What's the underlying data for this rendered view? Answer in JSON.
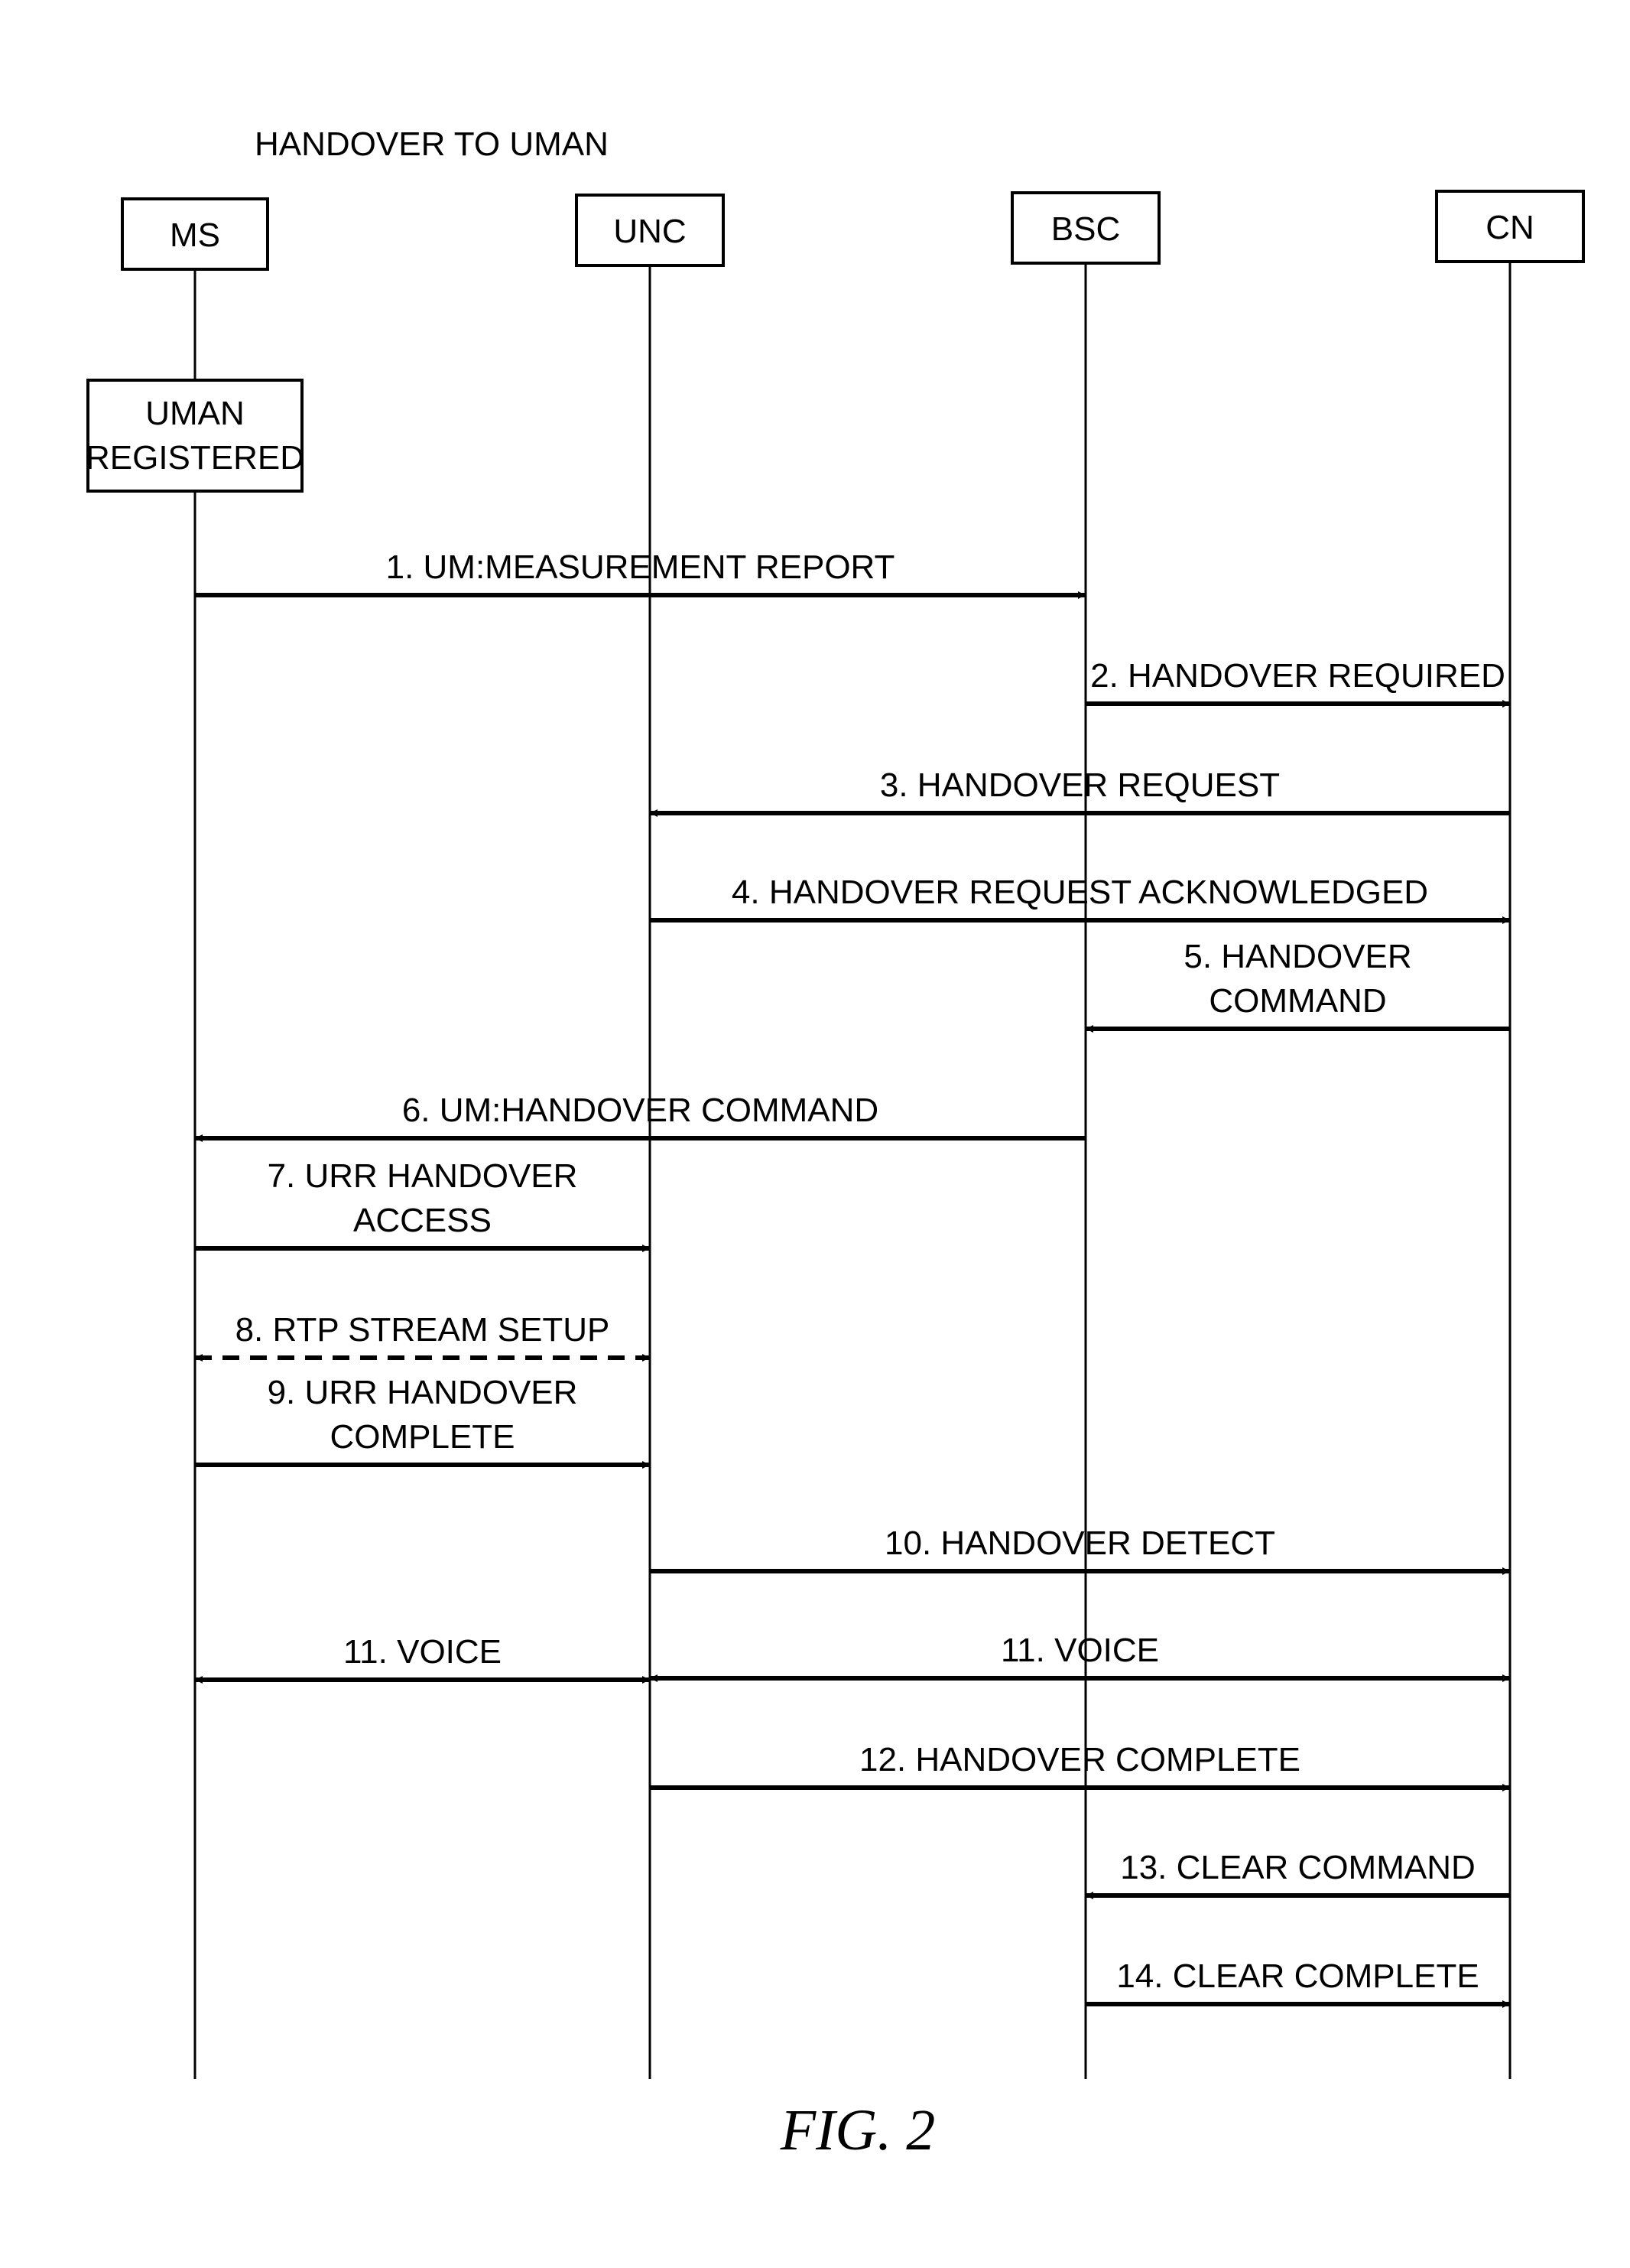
{
  "diagram": {
    "title": "HANDOVER TO UMAN",
    "figure_label": "FIG. 2",
    "entities": [
      {
        "id": "MS",
        "label": "MS"
      },
      {
        "id": "UNC",
        "label": "UNC"
      },
      {
        "id": "BSC",
        "label": "BSC"
      },
      {
        "id": "CN",
        "label": "CN"
      }
    ],
    "state_boxes": [
      {
        "entity": "MS",
        "lines": [
          "UMAN",
          "REGISTERED"
        ]
      }
    ],
    "messages": [
      {
        "n": 1,
        "from": "MS",
        "to": "BSC",
        "lines": [
          "1. UM:MEASUREMENT REPORT"
        ],
        "style": "solid",
        "bidirectional": false
      },
      {
        "n": 2,
        "from": "BSC",
        "to": "CN",
        "lines": [
          "2. HANDOVER REQUIRED"
        ],
        "style": "solid",
        "bidirectional": false
      },
      {
        "n": 3,
        "from": "CN",
        "to": "UNC",
        "lines": [
          "3. HANDOVER REQUEST"
        ],
        "style": "solid",
        "bidirectional": false
      },
      {
        "n": 4,
        "from": "UNC",
        "to": "CN",
        "lines": [
          "4. HANDOVER REQUEST ACKNOWLEDGED"
        ],
        "style": "solid",
        "bidirectional": false
      },
      {
        "n": 5,
        "from": "CN",
        "to": "BSC",
        "lines": [
          "5. HANDOVER",
          "COMMAND"
        ],
        "style": "solid",
        "bidirectional": false
      },
      {
        "n": 6,
        "from": "BSC",
        "to": "MS",
        "lines": [
          "6. UM:HANDOVER COMMAND"
        ],
        "style": "solid",
        "bidirectional": false
      },
      {
        "n": 7,
        "from": "MS",
        "to": "UNC",
        "lines": [
          "7. URR HANDOVER",
          "ACCESS"
        ],
        "style": "solid",
        "bidirectional": false
      },
      {
        "n": 8,
        "from": "MS",
        "to": "UNC",
        "lines": [
          "8. RTP STREAM SETUP"
        ],
        "style": "dashed",
        "bidirectional": true
      },
      {
        "n": 9,
        "from": "MS",
        "to": "UNC",
        "lines": [
          "9. URR HANDOVER",
          "COMPLETE"
        ],
        "style": "solid",
        "bidirectional": false
      },
      {
        "n": 10,
        "from": "UNC",
        "to": "CN",
        "lines": [
          "10. HANDOVER DETECT"
        ],
        "style": "solid",
        "bidirectional": false
      },
      {
        "n": 11,
        "from": "MS",
        "to": "UNC",
        "lines": [
          "11. VOICE"
        ],
        "style": "solid",
        "bidirectional": true
      },
      {
        "n": 11,
        "from": "UNC",
        "to": "CN",
        "lines": [
          "11. VOICE"
        ],
        "style": "solid",
        "bidirectional": true
      },
      {
        "n": 12,
        "from": "UNC",
        "to": "CN",
        "lines": [
          "12. HANDOVER COMPLETE"
        ],
        "style": "solid",
        "bidirectional": false
      },
      {
        "n": 13,
        "from": "CN",
        "to": "BSC",
        "lines": [
          "13. CLEAR COMMAND"
        ],
        "style": "solid",
        "bidirectional": false
      },
      {
        "n": 14,
        "from": "BSC",
        "to": "CN",
        "lines": [
          "14. CLEAR COMPLETE"
        ],
        "style": "solid",
        "bidirectional": false
      }
    ]
  }
}
